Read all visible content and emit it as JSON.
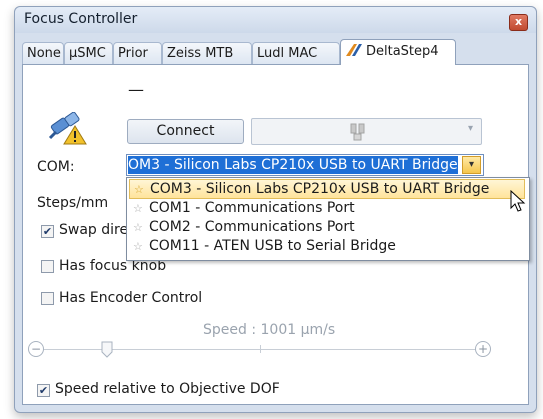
{
  "window": {
    "title": "Focus Controller",
    "close_glyph": "x"
  },
  "tabs": [
    {
      "label": "None"
    },
    {
      "label": "µSMC"
    },
    {
      "label": "Prior"
    },
    {
      "label": "Zeiss MTB"
    },
    {
      "label": "Ludl MAC"
    },
    {
      "label": "DeltaStep4",
      "active": true
    }
  ],
  "status": {
    "dash": "—",
    "icon": "disconnected-plug-warning-icon"
  },
  "connect": {
    "label": "Connect",
    "device_icon": "device-icon"
  },
  "com": {
    "label": "COM:",
    "selected": "OM3 - Silicon Labs CP210x USB to UART Bridge",
    "options": [
      "COM3 - Silicon Labs CP210x USB to UART Bridge",
      "COM1 - Communications Port",
      "COM2 - Communications Port",
      "COM11 - ATEN USB to Serial Bridge"
    ]
  },
  "settings": {
    "steps_label": "Steps/mm",
    "swap_label": "Swap dire",
    "focus_knob_label": "Has focus knob",
    "encoder_label": "Has Encoder Control"
  },
  "speed": {
    "label": "Speed : 1001 µm/s",
    "minus": "−",
    "plus": "+"
  },
  "dof_label": "Speed relative to Objective DOF",
  "colors": {
    "selection": "#1e6fd6",
    "highlight": "#ffe49b"
  }
}
